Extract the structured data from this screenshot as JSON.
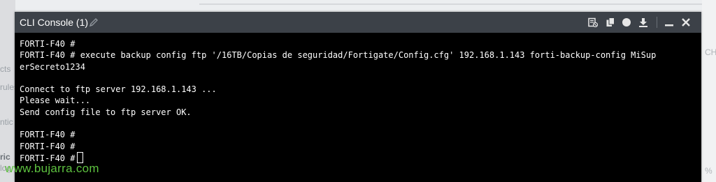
{
  "background": {
    "left_fragments": [
      "cts",
      "rules",
      "ntic",
      "ric",
      "log"
    ],
    "right_fragments": [
      "CH",
      "%"
    ]
  },
  "console": {
    "title": "CLI Console (1)",
    "icons": [
      "clear-console-icon",
      "copy-icon",
      "record-icon",
      "download-icon",
      "minimize-icon",
      "close-icon"
    ],
    "lines": [
      "FORTI-F40 #",
      "FORTI-F40 # execute backup config ftp '/16TB/Copias de seguridad/Fortigate/Config.cfg' 192.168.1.143 forti-backup-config MiSup",
      "erSecreto1234",
      "",
      "Connect to ftp server 192.168.1.143 ...",
      "Please wait...",
      "Send config file to ftp server OK.",
      "",
      "FORTI-F40 #",
      "FORTI-F40 #",
      "FORTI-F40 #"
    ]
  },
  "watermark": "www.bujarra.com",
  "colors": {
    "titlebar": "#3c4148",
    "terminal_bg": "#000000",
    "terminal_fg": "#ffffff",
    "watermark": "#5dc13f"
  }
}
